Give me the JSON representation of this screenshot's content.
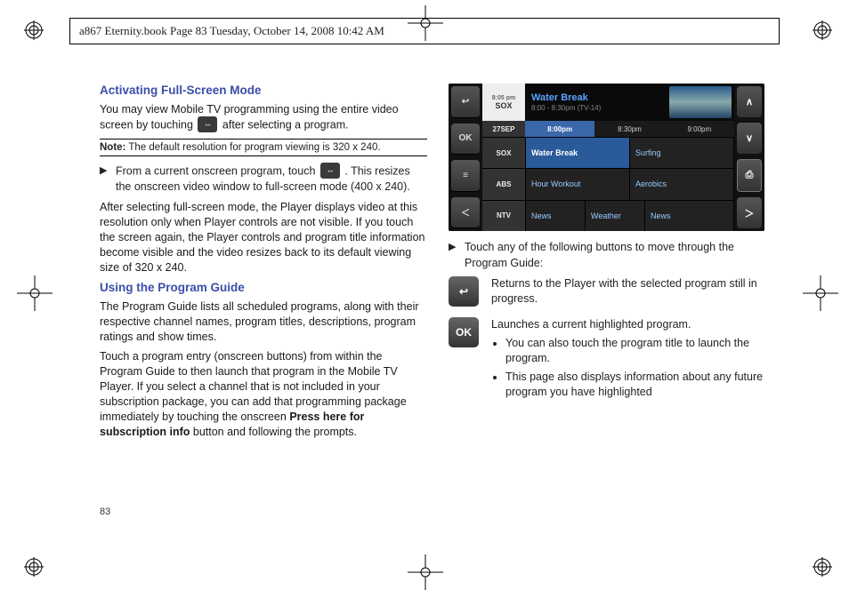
{
  "frame_header": "a867 Eternity.book  Page 83  Tuesday, October 14, 2008  10:42 AM",
  "page_number": "83",
  "left": {
    "h1": "Activating Full-Screen Mode",
    "p1a": "You may view Mobile TV programming using the entire video screen by touching ",
    "p1b": " after selecting a program.",
    "note_label": "Note:",
    "note_text": " The default resolution for program viewing is 320 x 240.",
    "step1a": "From a current onscreen program, touch ",
    "step1b": " . This resizes the onscreen video window to full-screen mode (400 x 240).",
    "p2": "After selecting full-screen mode, the Player displays video at this resolution only when Player controls are not visible. If you touch the screen again, the Player controls and program title information become visible and the video resizes back to its default viewing size of 320 x 240.",
    "h2": "Using the Program Guide",
    "p3": "The Program Guide lists all scheduled programs, along with their respective channel names, program titles, descriptions, program ratings and show times.",
    "p4a": "Touch a program entry (onscreen buttons) from within the Program Guide to then launch that program in the Mobile TV Player. If you select a channel that is not included in your subscription package, you can add that programming package immediately by touching the onscreen ",
    "p4_bold": "Press here for subscription info",
    "p4b": " button and following the prompts."
  },
  "guide": {
    "time_header": "8:05 pm",
    "channels_date": "27SEP",
    "channels": [
      "SOX",
      "SOX",
      "ABS",
      "NTV"
    ],
    "times": [
      "8:00pm",
      "8:30pm",
      "9:00pm"
    ],
    "featured_title": "Water Break",
    "featured_sub": "8:00 - 8:30pm (TV-14)",
    "rows": [
      {
        "ch": "SOX",
        "cells": [
          "Water Break",
          "Surfing"
        ]
      },
      {
        "ch": "ABS",
        "cells": [
          "Hour Workout",
          "Aerobics"
        ]
      },
      {
        "ch": "NTV",
        "cells": [
          "News",
          "Weather",
          "News"
        ]
      }
    ],
    "left_buttons": [
      "↩",
      "OK",
      "≡"
    ],
    "right_buttons": [
      "∧",
      "∨",
      "⎙"
    ],
    "foot_left": "＜",
    "foot_right": "＞"
  },
  "right": {
    "step2": "Touch any of the following buttons to move through the Program Guide:",
    "back_label": "↩",
    "back_desc": "Returns to the Player with the selected program still in progress.",
    "ok_label": "OK",
    "ok_desc": "Launches a current highlighted program.",
    "ok_b1": "You can also touch the program title to launch the program.",
    "ok_b2": "This page also displays information about any future program you have highlighted"
  }
}
